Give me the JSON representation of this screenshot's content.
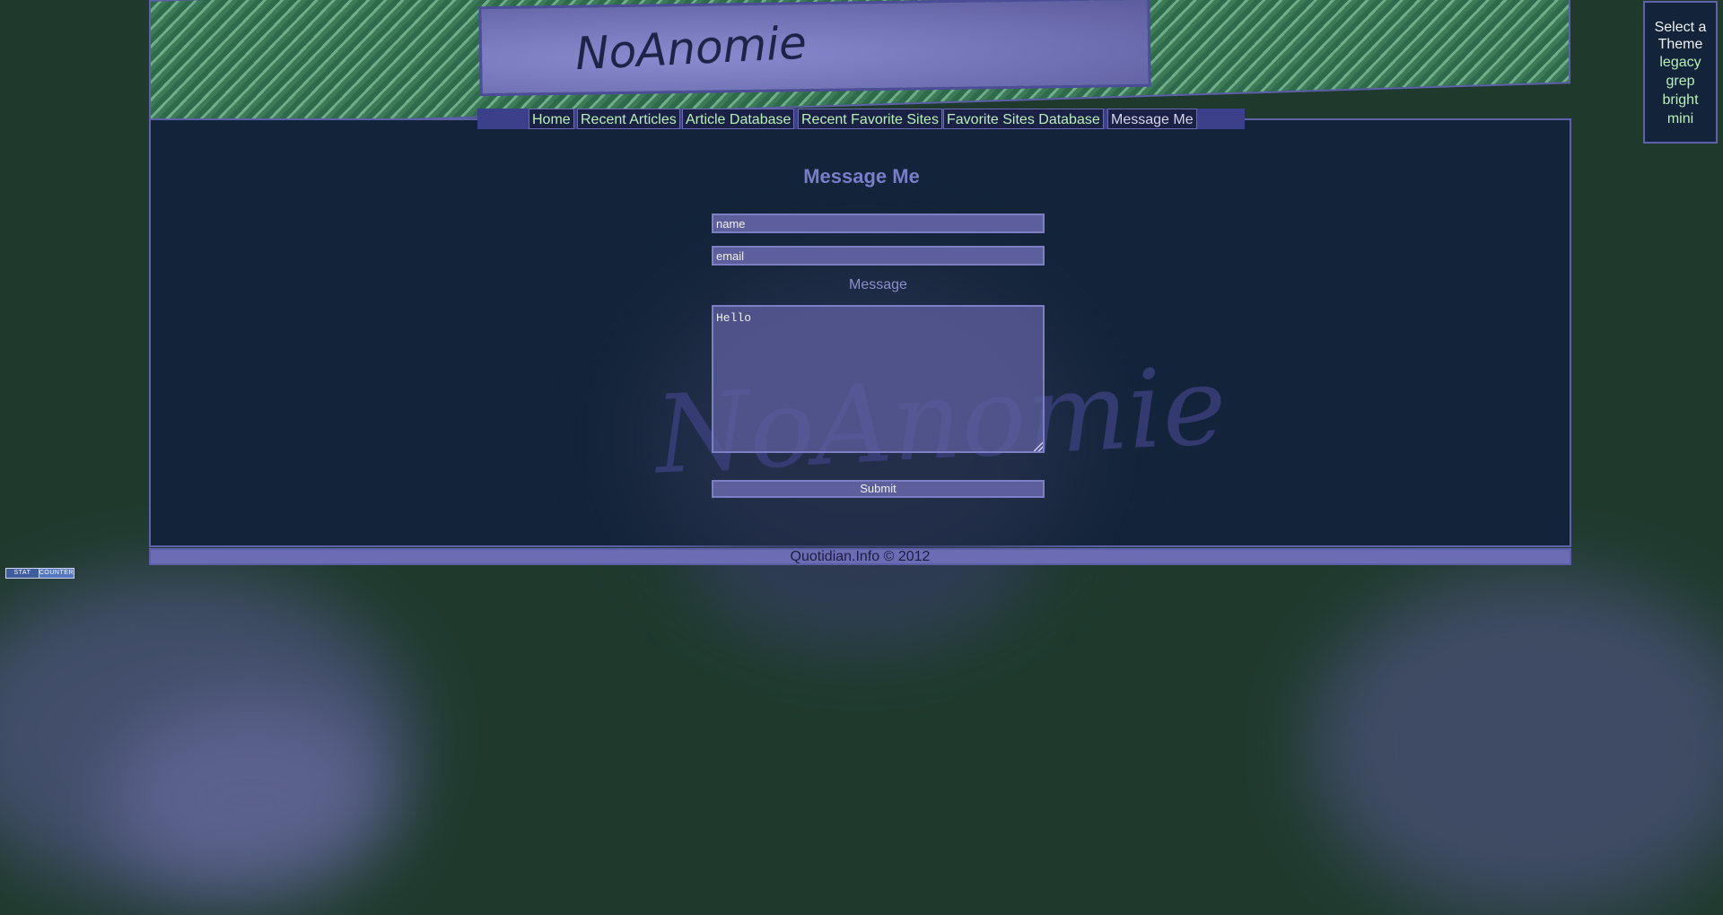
{
  "site": {
    "logo_text": "NoAnomie",
    "watermark_text": "NoAnomie"
  },
  "nav": {
    "items": [
      {
        "label": "Home"
      },
      {
        "label": "Recent Articles"
      },
      {
        "label": "Article Database"
      },
      {
        "label": "Recent Favorite Sites"
      },
      {
        "label": "Favorite Sites Database"
      },
      {
        "label": "Message Me"
      }
    ]
  },
  "page": {
    "title": "Message Me"
  },
  "form": {
    "name_value": "name",
    "email_value": "email",
    "message_label": "Message",
    "message_value": "Hello",
    "submit_label": "Submit"
  },
  "footer": {
    "copyright": "Quotidian.Info © 2012"
  },
  "stat_counter": {
    "left": "STAT",
    "right": "COUNTER"
  },
  "theme_selector": {
    "title_line1": "Select a",
    "title_line2": "Theme",
    "options": [
      "legacy",
      "grep",
      "bright",
      "mini"
    ]
  },
  "colors": {
    "background": "#1f3a2d",
    "panel": "#13243a",
    "accent": "#6c6cb4",
    "link": "#b8f0b8"
  }
}
